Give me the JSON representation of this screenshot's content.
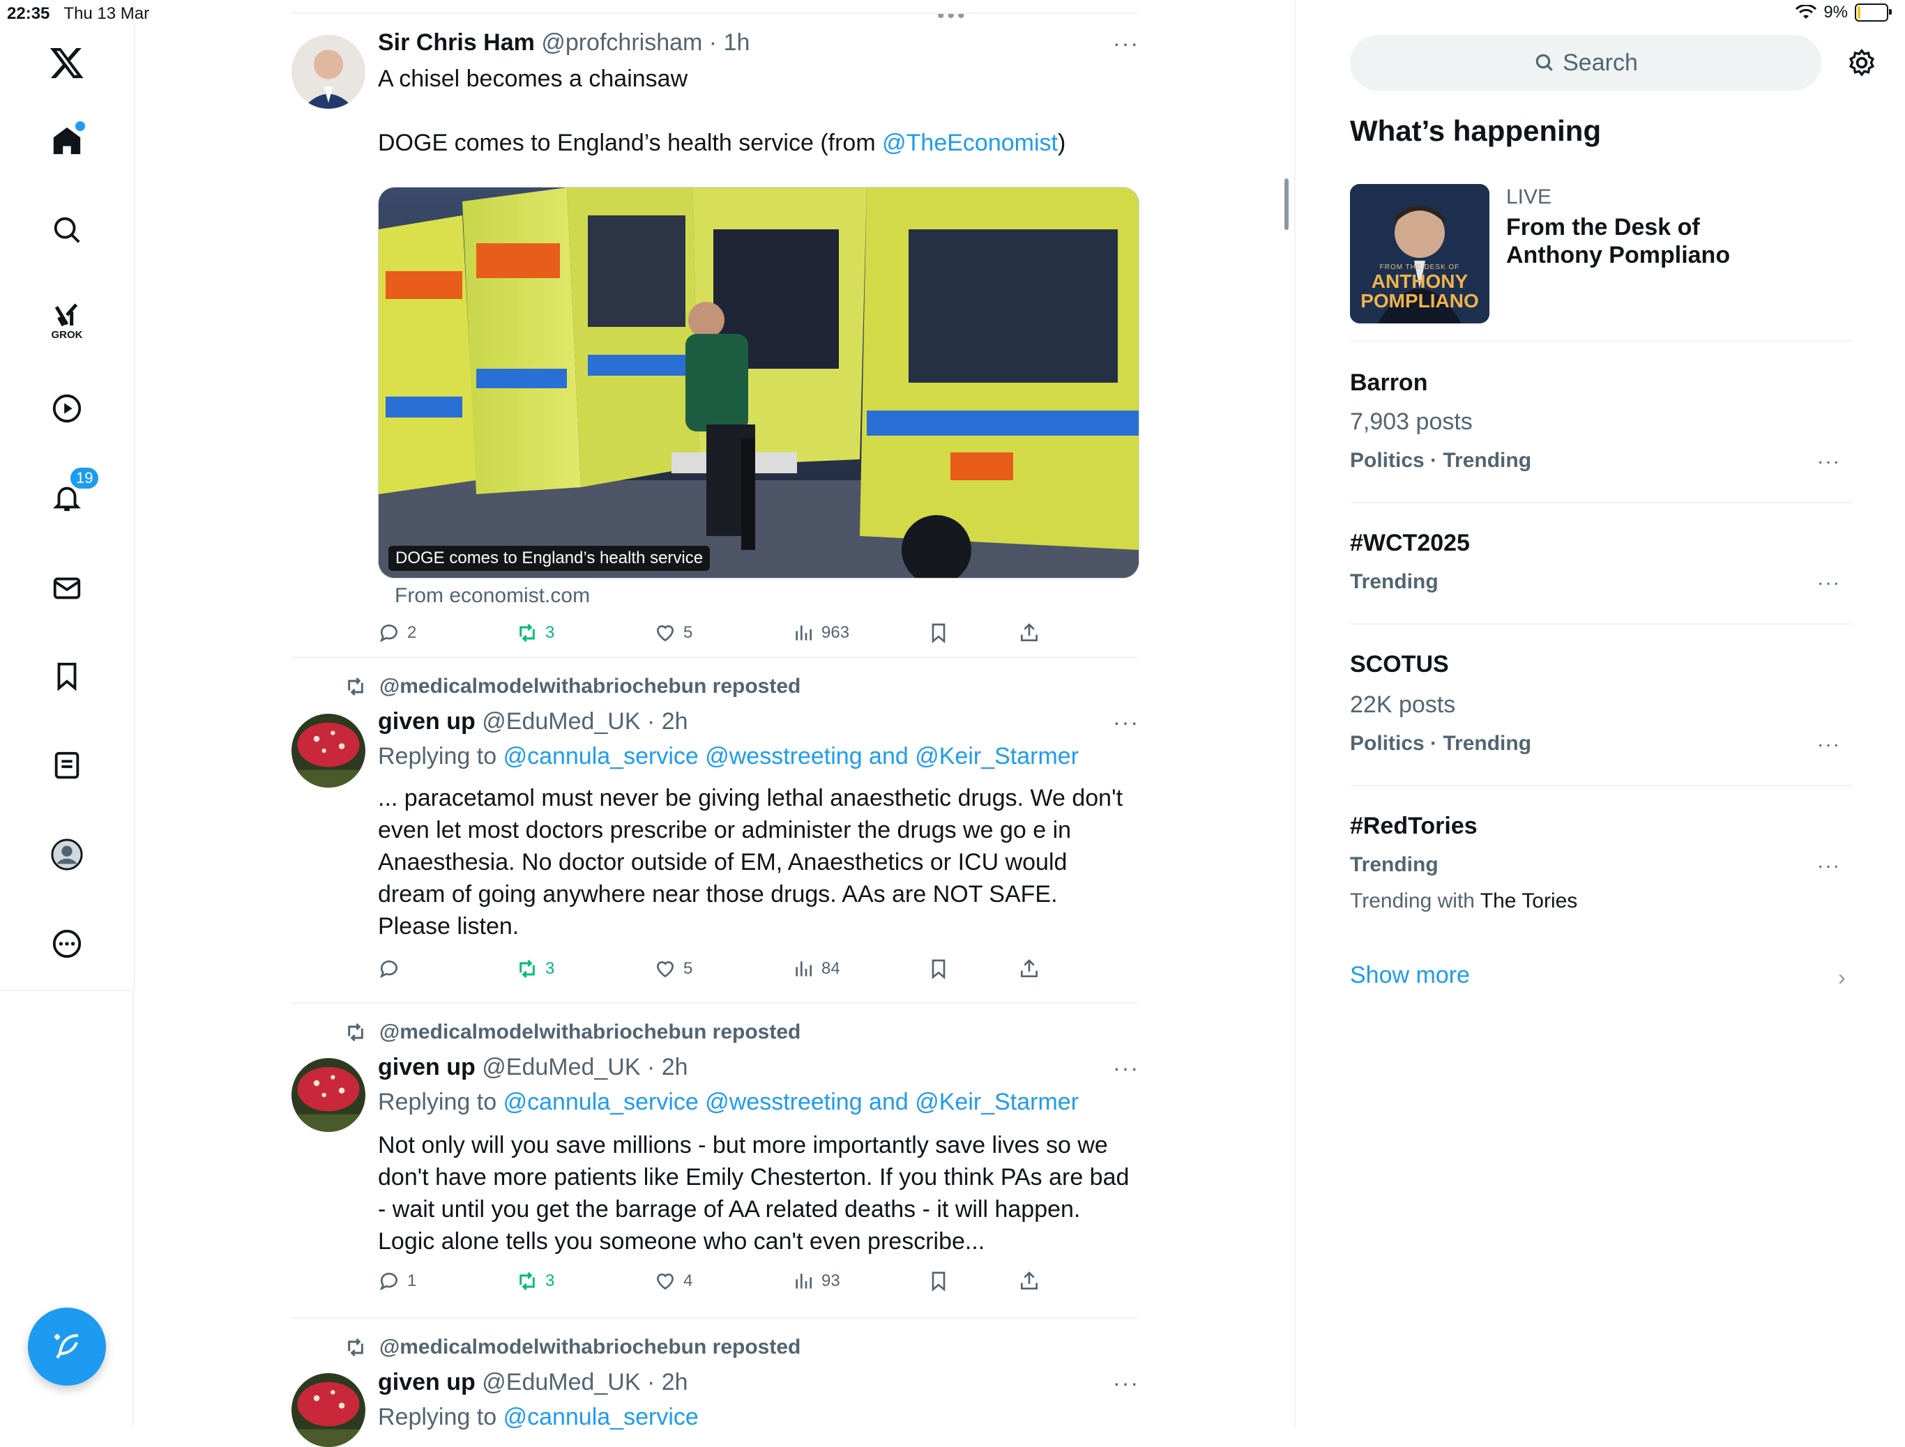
{
  "status": {
    "time": "22:35",
    "date": "Thu 13 Mar",
    "battery": "9%"
  },
  "nav": {
    "notifications_badge": "19",
    "grok_label": "GROK"
  },
  "search": {
    "placeholder": "Search"
  },
  "feed": {
    "tweets": [
      {
        "name": "Sir Chris Ham",
        "handle": "@profchrisham",
        "time": "· 1h",
        "line1": "A chisel becomes a chainsaw",
        "line2_pre": "DOGE comes to England’s health service (from ",
        "line2_link": "@TheEconomist",
        "line2_post": ")",
        "media_caption": "DOGE comes to England’s health service",
        "from": "From economist.com",
        "replies": "2",
        "reposts": "3",
        "likes": "5",
        "views": "963"
      },
      {
        "repost_by": "@medicalmodelwithabriochebun reposted",
        "name": "given up",
        "handle": "@EduMed_UK",
        "time": "· 2h",
        "replying_label": "Replying to",
        "replying_to": "@cannula_service @wesstreeting and @Keir_Starmer",
        "text": "... paracetamol must never be giving lethal anaesthetic drugs. We don't even let most doctors prescribe or administer the drugs we go e in Anaesthesia. No doctor outside of EM, Anaesthetics or ICU would dream of going anywhere near those drugs. AAs are NOT SAFE. Please listen.",
        "replies": "",
        "reposts": "3",
        "likes": "5",
        "views": "84"
      },
      {
        "repost_by": "@medicalmodelwithabriochebun reposted",
        "name": "given up",
        "handle": "@EduMed_UK",
        "time": "· 2h",
        "replying_label": "Replying to",
        "replying_to": "@cannula_service @wesstreeting and @Keir_Starmer",
        "text": "Not only will you save millions - but more importantly save lives so we don't have more patients like Emily Chesterton. If you think PAs are bad - wait until you get the barrage of AA related deaths - it will happen. Logic alone tells you someone who can't even prescribe...",
        "replies": "1",
        "reposts": "3",
        "likes": "4",
        "views": "93"
      },
      {
        "repost_by": "@medicalmodelwithabriochebun reposted",
        "name": "given up",
        "handle": "@EduMed_UK",
        "time": "· 2h",
        "replying_label": "Replying to",
        "replying_to": "@cannula_service"
      }
    ]
  },
  "sidebar": {
    "title": "What’s happening",
    "live": {
      "label": "LIVE",
      "title": "From the Desk of Anthony Pompliano",
      "thumb_small": "FROM THE DESK OF",
      "thumb_line1": "ANTHONY",
      "thumb_line2": "POMPLIANO"
    },
    "trends": [
      {
        "title": "Barron",
        "sub": "7,903 posts",
        "meta": "Politics · Trending"
      },
      {
        "title": "#WCT2025",
        "meta": "Trending"
      },
      {
        "title": "SCOTUS",
        "sub": "22K posts",
        "meta": "Politics · Trending"
      },
      {
        "title": "#RedTories",
        "meta": "Trending",
        "with_pre": "Trending with ",
        "with_name": "The Tories"
      }
    ],
    "show_more": "Show more"
  },
  "colors": {
    "accent": "#1d9bf0",
    "repost_green": "#00ba7c",
    "muted": "#536471"
  }
}
